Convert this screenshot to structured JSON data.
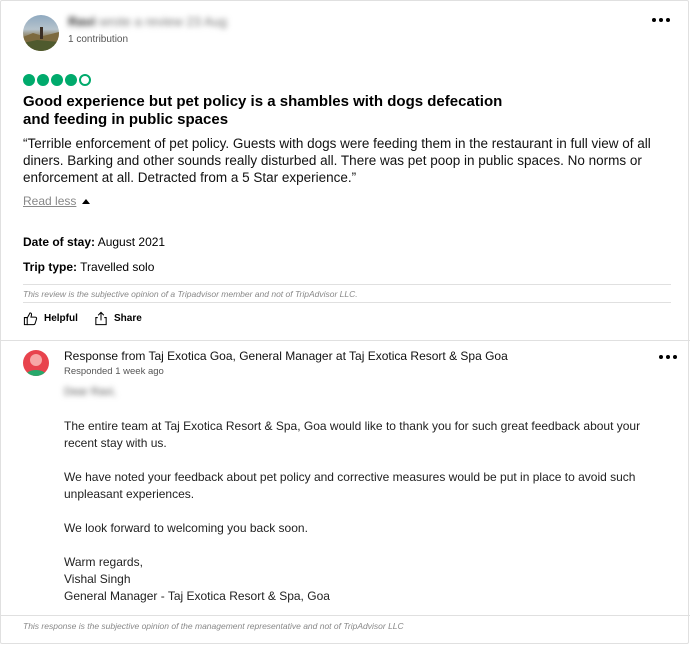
{
  "reviewer": {
    "name": "Ravi",
    "name_rest": "wrote a review 23 Aug",
    "contributions": "1 contribution"
  },
  "review": {
    "rating": 4,
    "rating_max": 5,
    "title": "Good experience but pet policy is a shambles with dogs defecation and feeding in public spaces",
    "text": "“Terrible enforcement of pet policy. Guests with dogs were feeding them in the restaurant in full view of all diners. Barking and other sounds really disturbed all. There was pet poop in public spaces. No norms or enforcement at all. Detracted from a 5 Star experience.”",
    "read_less": "Read less",
    "date_label": "Date of stay:",
    "date_value": "August 2021",
    "trip_label": "Trip type:",
    "trip_value": "Travelled solo",
    "disclaimer": "This review is the subjective opinion of a Tripadvisor member and not of TripAdvisor LLC."
  },
  "actions": {
    "helpful": "Helpful",
    "share": "Share"
  },
  "response": {
    "title": "Response from Taj Exotica Goa, General Manager at Taj Exotica Resort & Spa Goa",
    "date": "Responded 1 week ago",
    "blurred_line": "Dear Ravi,",
    "p1": "The entire team at Taj Exotica Resort & Spa, Goa would like to thank you for such great feedback about your recent stay with us.",
    "p2": "We have noted your feedback about pet policy and corrective measures would be put in place to avoid such unpleasant experiences.",
    "p3": "We look forward to welcoming you back soon.",
    "sign_1": "Warm regards,",
    "sign_2": "Vishal Singh",
    "sign_3": "General Manager - Taj Exotica Resort & Spa, Goa",
    "disclaimer": "This response is the subjective opinion of the management representative and not of TripAdvisor LLC"
  },
  "colors": {
    "rating": "#00aa6c",
    "response_avatar": "#e8434d"
  },
  "icons": {
    "more": "three-dots-icon",
    "helpful": "thumbs-up-icon",
    "share": "share-icon",
    "read_less": "caret-up-icon"
  }
}
